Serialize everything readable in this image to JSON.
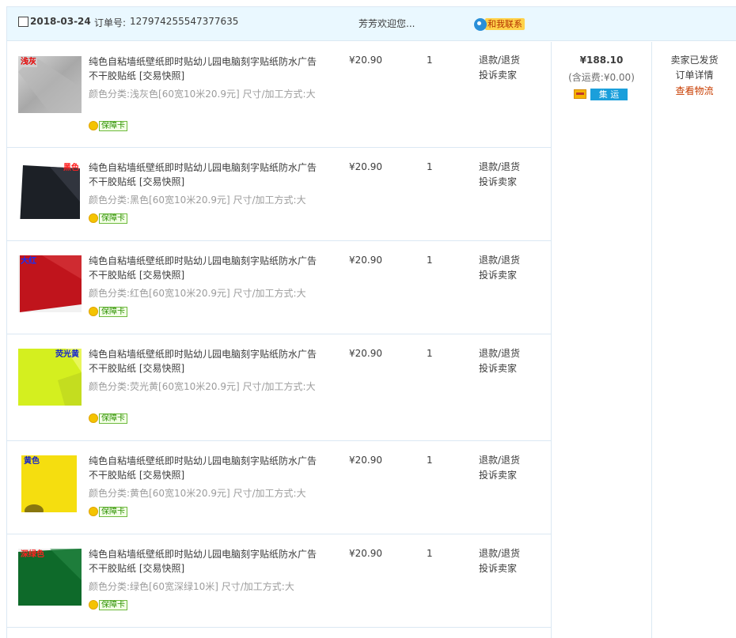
{
  "header": {
    "date": "2018-03-24",
    "order_label": "订单号:",
    "order_number": "127974255547377635",
    "shop_name": "芳芳欢迎您...",
    "contact_label": "和我联系"
  },
  "items": [
    {
      "thumb_label": "浅灰",
      "thumb_color": "#b5b5b5",
      "label_color": "#e60000",
      "title": "纯色自粘墙纸壁纸即时贴幼儿园电脑刻字贴纸防水广告不干胶贴纸 [交易快照]",
      "spec": "颜色分类:浅灰色[60宽10米20.9元] 尺寸/加工方式:大",
      "badge": "保障卡",
      "price": "¥20.90",
      "qty": "1",
      "action1": "退款/退货",
      "action2": "投诉卖家"
    },
    {
      "thumb_label": "黑色",
      "thumb_color": "#22262c",
      "label_color": "#ff2020",
      "title": "纯色自粘墙纸壁纸即时贴幼儿园电脑刻字贴纸防水广告不干胶贴纸 [交易快照]",
      "spec": "颜色分类:黑色[60宽10米20.9元] 尺寸/加工方式:大",
      "badge": "保障卡",
      "price": "¥20.90",
      "qty": "1",
      "action1": "退款/退货",
      "action2": "投诉卖家"
    },
    {
      "thumb_label": "大红",
      "thumb_color": "#c2161f",
      "label_color": "#1030ff",
      "title": "纯色自粘墙纸壁纸即时贴幼儿园电脑刻字贴纸防水广告不干胶贴纸 [交易快照]",
      "spec": "颜色分类:红色[60宽10米20.9元] 尺寸/加工方式:大",
      "badge": "保障卡",
      "price": "¥20.90",
      "qty": "1",
      "action1": "退款/退货",
      "action2": "投诉卖家"
    },
    {
      "thumb_label": "荧光黄",
      "thumb_color": "#d6f229",
      "label_color": "#1020d0",
      "title": "纯色自粘墙纸壁纸即时贴幼儿园电脑刻字贴纸防水广告不干胶贴纸 [交易快照]",
      "spec": "颜色分类:荧光黄[60宽10米20.9元] 尺寸/加工方式:大",
      "badge": "保障卡",
      "price": "¥20.90",
      "qty": "1",
      "action1": "退款/退货",
      "action2": "投诉卖家"
    },
    {
      "thumb_label": "黄色",
      "thumb_color": "#f3dc12",
      "label_color": "#1020d0",
      "title": "纯色自粘墙纸壁纸即时贴幼儿园电脑刻字贴纸防水广告不干胶贴纸 [交易快照]",
      "spec": "颜色分类:黄色[60宽10米20.9元] 尺寸/加工方式:大",
      "badge": "保障卡",
      "price": "¥20.90",
      "qty": "1",
      "action1": "退款/退货",
      "action2": "投诉卖家"
    },
    {
      "thumb_label": "深绿色",
      "thumb_color": "#0f6b2a",
      "label_color": "#ff2020",
      "title": "纯色自粘墙纸壁纸即时贴幼儿园电脑刻字贴纸防水广告不干胶贴纸 [交易快照]",
      "spec": "颜色分类:绿色[60宽深绿10米] 尺寸/加工方式:大",
      "badge": "保障卡",
      "price": "¥20.90",
      "qty": "1",
      "action1": "退款/退货",
      "action2": "投诉卖家"
    }
  ],
  "total": {
    "price": "¥188.10",
    "shipping": "(含运费:¥0.00)",
    "collect_label": "集 运"
  },
  "status": {
    "state": "卖家已发货",
    "detail_link": "订单详情",
    "logistics_link": "查看物流"
  }
}
